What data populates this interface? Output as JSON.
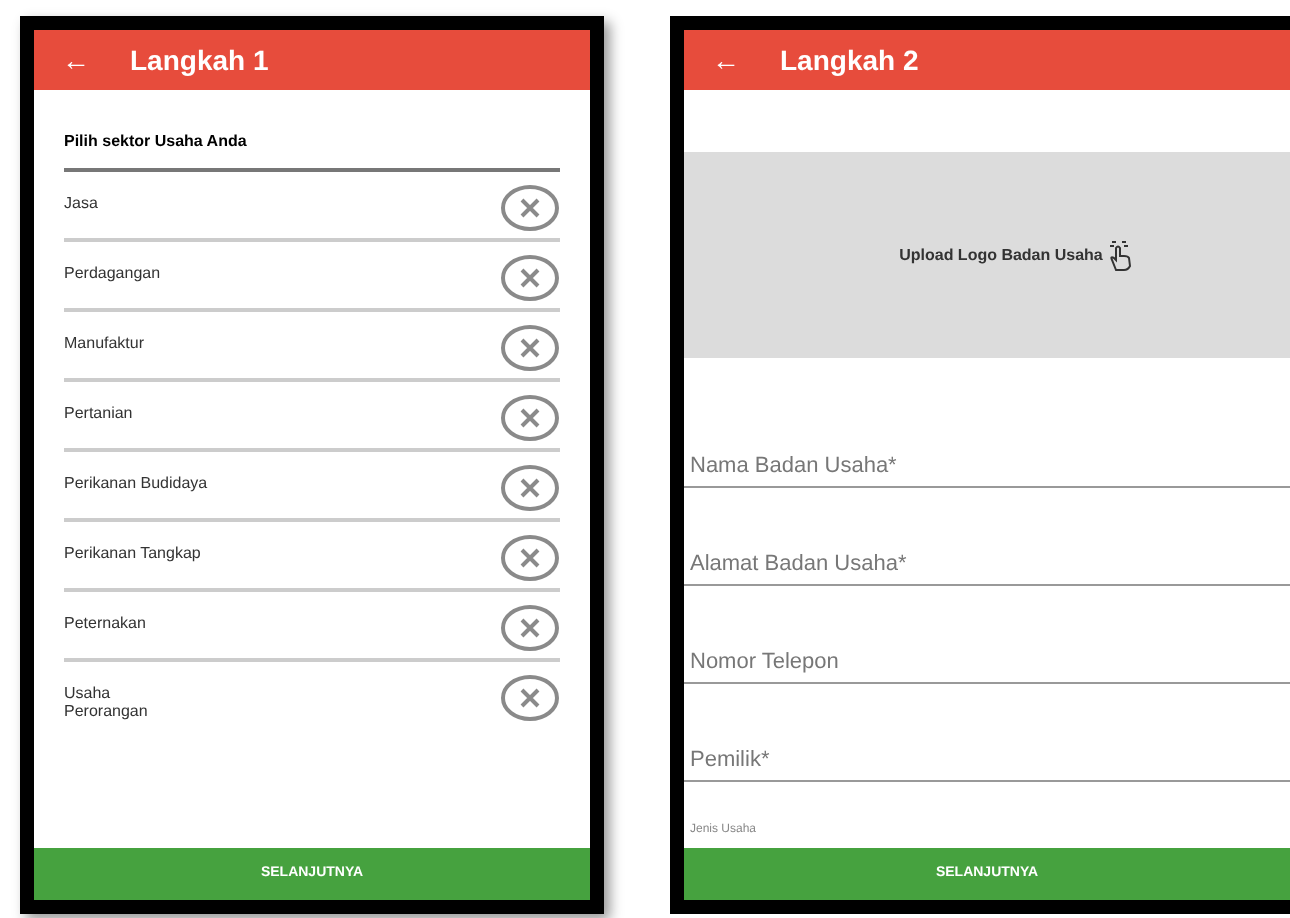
{
  "step1": {
    "back": "←",
    "title": "Langkah 1",
    "section_label": "Pilih sektor Usaha Anda",
    "sectors": [
      {
        "name": "Jasa"
      },
      {
        "name": "Perdagangan"
      },
      {
        "name": "Manufaktur"
      },
      {
        "name": "Pertanian"
      },
      {
        "name": "Perikanan Budidaya"
      },
      {
        "name": "Perikanan Tangkap"
      },
      {
        "name": "Peternakan"
      },
      {
        "name": "Usaha\nPerorangan"
      }
    ],
    "button": "SELANJUTNYA"
  },
  "step2": {
    "back": "←",
    "title": "Langkah 2",
    "upload_label": "Upload Logo Badan Usaha",
    "fields": [
      {
        "placeholder": "Nama Badan Usaha*"
      },
      {
        "placeholder": "Alamat Badan Usaha*"
      },
      {
        "placeholder": "Nomor Telepon"
      },
      {
        "placeholder": "Pemilik*"
      }
    ],
    "business_type_label": "Jenis Usaha",
    "button": "SELANJUTNYA"
  }
}
